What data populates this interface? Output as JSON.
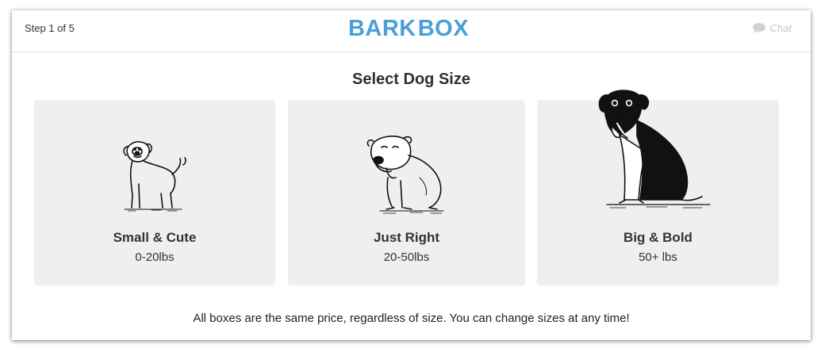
{
  "header": {
    "step_text": "Step 1 of 5",
    "logo_left": "BARK",
    "logo_right": "BOX",
    "chat_label": "Chat",
    "chat_icon": "chat-bubble-icon"
  },
  "page_title": "Select Dog Size",
  "sizes": [
    {
      "label": "Small & Cute",
      "weight": "0-20lbs",
      "icon": "small-dog-illustration"
    },
    {
      "label": "Just Right",
      "weight": "20-50lbs",
      "icon": "medium-dog-illustration"
    },
    {
      "label": "Big & Bold",
      "weight": "50+ lbs",
      "icon": "big-dog-illustration"
    }
  ],
  "footer_note": "All boxes are the same price, regardless of size. You can change sizes at any time!",
  "colors": {
    "brand_blue": "#4a9fd9",
    "card_bg": "#efefef",
    "text": "#333333"
  }
}
